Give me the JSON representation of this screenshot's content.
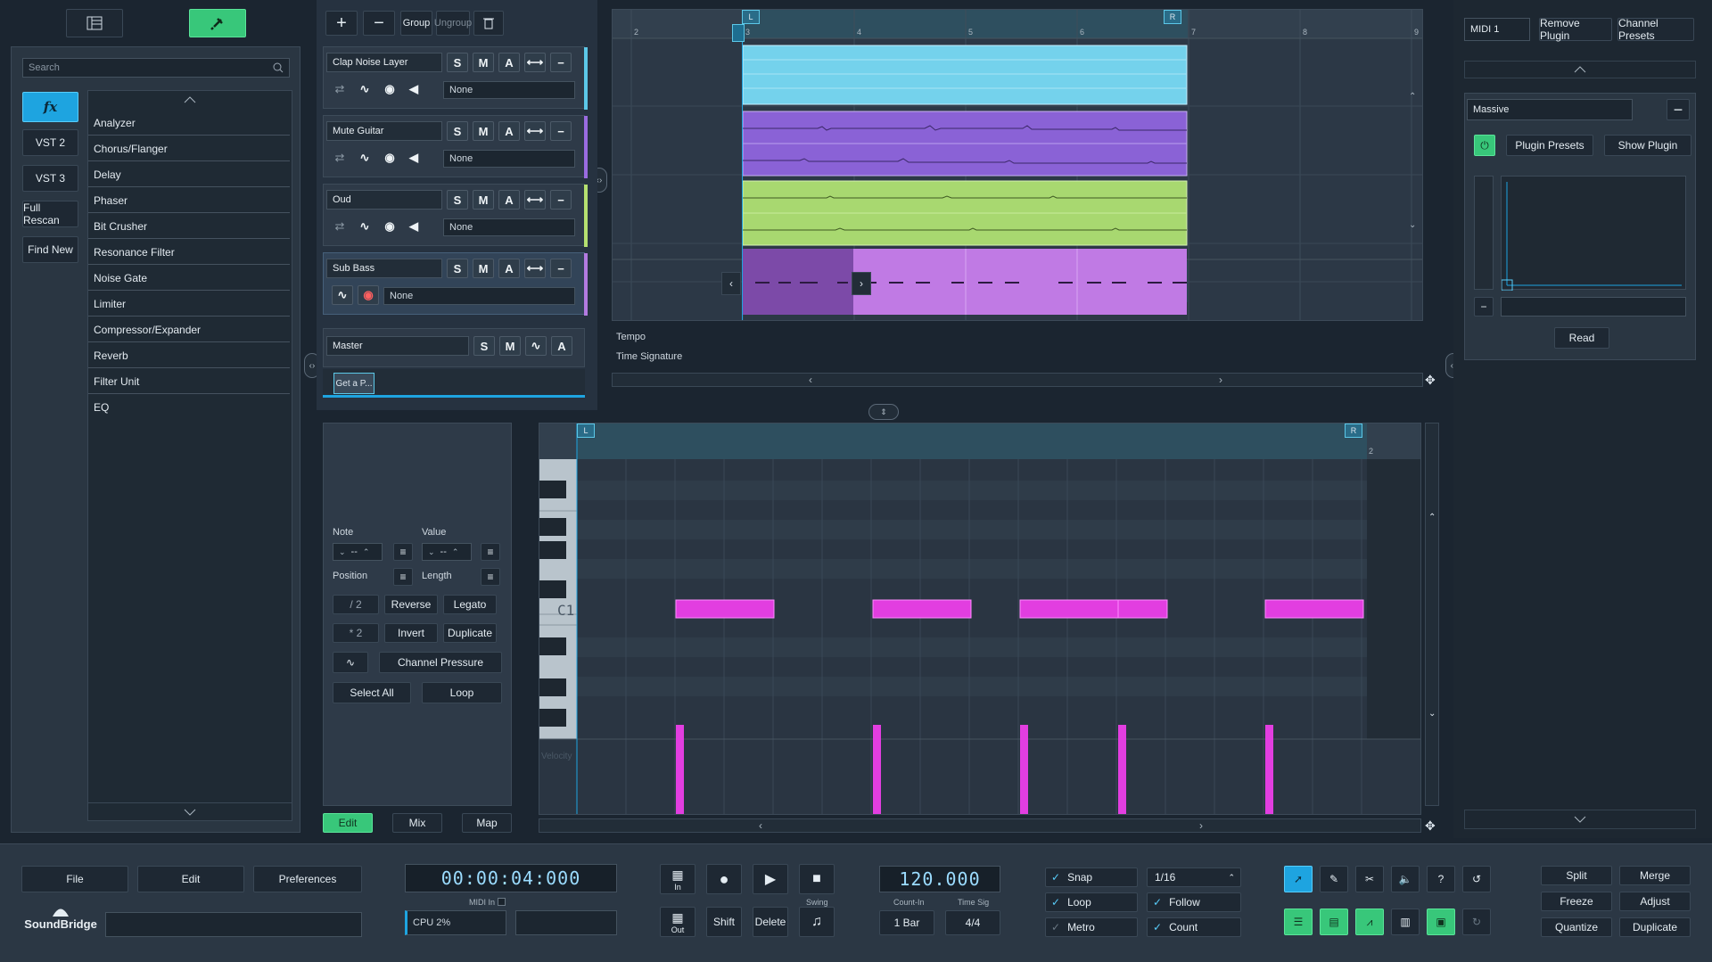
{
  "browser": {
    "search_placeholder": "Search",
    "fx_label": "fx",
    "tabs": [
      "VST 2",
      "VST 3",
      "Full Rescan",
      "Find New"
    ],
    "effects": [
      "Analyzer",
      "Chorus/Flanger",
      "Delay",
      "Phaser",
      "Bit Crusher",
      "Resonance Filter",
      "Noise Gate",
      "Limiter",
      "Compressor/Expander",
      "Reverb",
      "Filter Unit",
      "EQ"
    ]
  },
  "tracks_header": {
    "group": "Group",
    "ungroup": "Ungroup"
  },
  "tracks": [
    {
      "name": "Clap Noise Layer",
      "input": "None",
      "color": "#5cc8e8"
    },
    {
      "name": "Mute Guitar",
      "input": "None",
      "color": "#9a6be0"
    },
    {
      "name": "Oud",
      "input": "None",
      "color": "#b5e070"
    },
    {
      "name": "Sub Bass",
      "input": "None",
      "color": "#b37ae0"
    }
  ],
  "track_buttons": {
    "solo": "S",
    "mute": "M",
    "auto": "A"
  },
  "master": {
    "name": "Master",
    "solo": "S",
    "mute": "M",
    "auto": "A"
  },
  "plugin_tab": "Get a P...",
  "arrange": {
    "ruler": [
      "2",
      "3",
      "4",
      "5",
      "6",
      "7",
      "8",
      "9"
    ],
    "loop_left": "L",
    "loop_right": "R",
    "tempo_label": "Tempo",
    "timesig_label": "Time Signature"
  },
  "plugin_panel": {
    "midi_label": "MIDI 1",
    "remove_plugin": "Remove Plugin",
    "channel_presets": "Channel Presets",
    "plugin_name": "Massive",
    "plugin_presets": "Plugin Presets",
    "show_plugin": "Show Plugin",
    "read": "Read"
  },
  "editor": {
    "note_label": "Note",
    "value_label": "Value",
    "note_value": "--",
    "value_value": "--",
    "position_label": "Position",
    "length_label": "Length",
    "half": "/ 2",
    "double": "* 2",
    "reverse": "Reverse",
    "legato": "Legato",
    "invert": "Invert",
    "duplicate": "Duplicate",
    "channel_pressure": "Channel Pressure",
    "select_all": "Select All",
    "loop": "Loop",
    "tabs": [
      "Edit",
      "Mix",
      "Map"
    ],
    "c1_label": "C1",
    "velocity_label": "Velocity",
    "ruler_label": "2",
    "loop_left": "L",
    "loop_right": "R"
  },
  "transport": {
    "file": "File",
    "edit": "Edit",
    "preferences": "Preferences",
    "brand": "SoundBridge",
    "time": "00:00:04:000",
    "midi_in": "MIDI In",
    "cpu": "CPU 2%",
    "in_label": "In",
    "out_label": "Out",
    "shift": "Shift",
    "delete": "Delete",
    "swing": "Swing",
    "tempo": "120.000",
    "count_in_label": "Count-In",
    "time_sig_label": "Time Sig",
    "count_in": "1 Bar",
    "time_sig": "4/4",
    "snap": "Snap",
    "loop": "Loop",
    "metro": "Metro",
    "grid": "1/16",
    "follow": "Follow",
    "count": "Count",
    "split": "Split",
    "merge": "Merge",
    "freeze": "Freeze",
    "adjust": "Adjust",
    "quantize": "Quantize",
    "duplicate": "Duplicate"
  },
  "colors": {
    "accent": "#1ea4e0",
    "green": "#38c77a",
    "note": "#e23ee0"
  }
}
